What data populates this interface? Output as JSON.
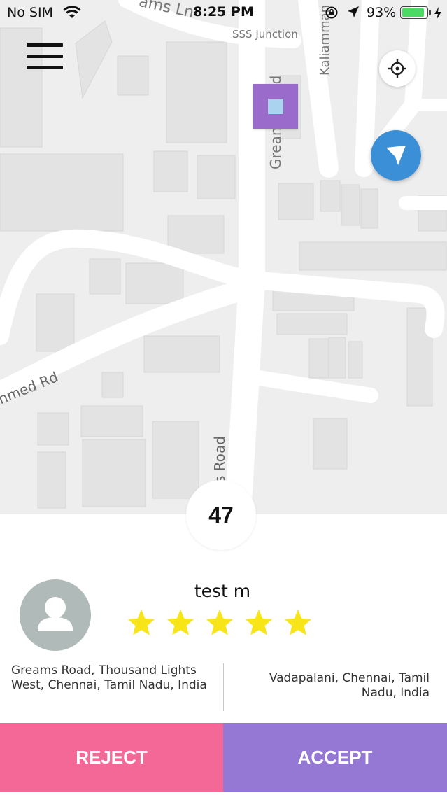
{
  "status_bar": {
    "carrier": "No SIM",
    "time": "8:25 PM",
    "battery_percent": "93%",
    "battery_level": 0.93,
    "icons": [
      "wifi-icon",
      "orientation-lock-icon",
      "location-arrow-icon",
      "battery-icon",
      "charging-bolt-icon"
    ]
  },
  "map": {
    "labels": {
      "top_road": "ams Ln",
      "junction": "SSS Junction",
      "kaliamman": "Kaliamman K",
      "greams_upper": "Greams Road",
      "greams_lower": "s Road",
      "left_road": "nmed Rd"
    },
    "controls": {
      "menu_icon": "hamburger-menu-icon",
      "locate_icon": "crosshair-icon",
      "driver_icon": "navigation-arrow-icon"
    },
    "colors": {
      "background": "#eeeeee",
      "road": "#ffffff",
      "building": "#e4e4e4",
      "driver_marker": "#3a8fd6",
      "destination_marker": "#9b6bcc"
    }
  },
  "countdown": "47",
  "rider": {
    "name": "test m",
    "rating": 5,
    "rating_max": 5,
    "star_color": "#f7e51a",
    "avatar_icon": "person-avatar-icon"
  },
  "trip": {
    "pickup": "Greams Road, Thousand Lights West, Chennai, Tamil Nadu, India",
    "dropoff": "Vadapalani, Chennai, Tamil Nadu, India"
  },
  "actions": {
    "reject_label": "REJECT",
    "accept_label": "ACCEPT",
    "reject_color": "#f36896",
    "accept_color": "#9577d4"
  }
}
